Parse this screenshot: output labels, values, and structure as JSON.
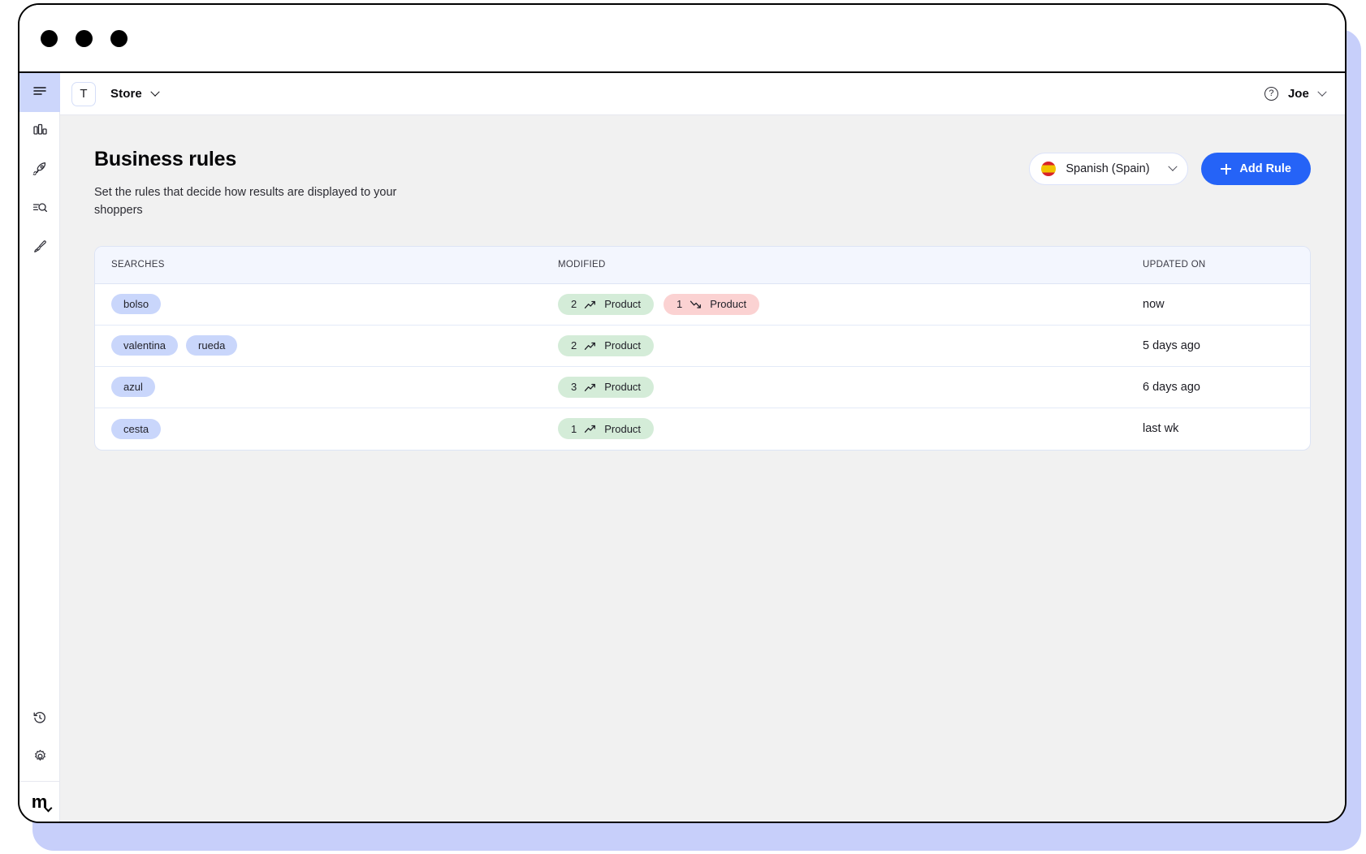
{
  "window": {
    "traffic_lights": [
      "close",
      "minimize",
      "maximize"
    ]
  },
  "sidebar": {
    "top_items": [
      {
        "name": "menu",
        "icon": "hamburger-menu-icon",
        "active": true
      },
      {
        "name": "analytics",
        "icon": "bar-chart-icon",
        "active": false
      },
      {
        "name": "launch",
        "icon": "rocket-icon",
        "active": false
      },
      {
        "name": "search-insights",
        "icon": "search-list-icon",
        "active": false
      },
      {
        "name": "personalization",
        "icon": "paintbrush-icon",
        "active": false
      }
    ],
    "bottom_items": [
      {
        "name": "history",
        "icon": "history-clock-icon"
      },
      {
        "name": "settings",
        "icon": "gear-icon"
      }
    ],
    "logo_text": "m"
  },
  "appbar": {
    "store_initial": "T",
    "store_label": "Store",
    "help_glyph": "?",
    "user_label": "Joe"
  },
  "page": {
    "title": "Business rules",
    "subtitle": "Set the rules that decide how results are displayed to your shoppers",
    "language_selector": {
      "flag": "spain-flag-icon",
      "label": "Spanish (Spain)"
    },
    "add_rule_label": "Add Rule"
  },
  "table": {
    "headers": {
      "searches": "SEARCHES",
      "modified": "MODIFIED",
      "updated_on": "UPDATED ON"
    },
    "rows": [
      {
        "searches": [
          "bolso"
        ],
        "modified": [
          {
            "count": "2",
            "direction": "up",
            "label": "Product"
          },
          {
            "count": "1",
            "direction": "down",
            "label": "Product"
          }
        ],
        "updated_on": "now"
      },
      {
        "searches": [
          "valentina",
          "rueda"
        ],
        "modified": [
          {
            "count": "2",
            "direction": "up",
            "label": "Product"
          }
        ],
        "updated_on": "5 days ago"
      },
      {
        "searches": [
          "azul"
        ],
        "modified": [
          {
            "count": "3",
            "direction": "up",
            "label": "Product"
          }
        ],
        "updated_on": "6 days ago"
      },
      {
        "searches": [
          "cesta"
        ],
        "modified": [
          {
            "count": "1",
            "direction": "up",
            "label": "Product"
          }
        ],
        "updated_on": "last wk"
      }
    ]
  },
  "colors": {
    "accent": "#2563f7",
    "pill_bg": "#c9d6fb",
    "badge_up_bg": "#d4ecd8",
    "badge_down_bg": "#fbd2d2",
    "page_bg": "#f1f1f1",
    "shadow": "#c7cffa"
  }
}
